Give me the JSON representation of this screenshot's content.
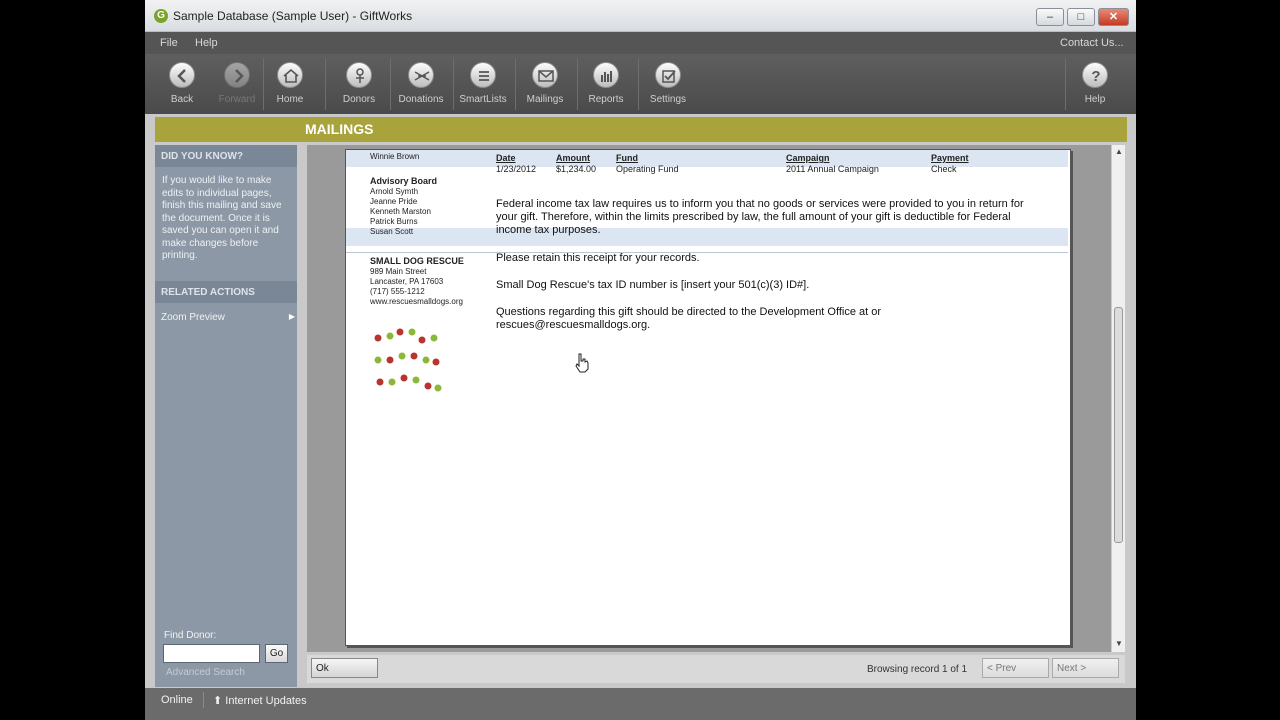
{
  "window": {
    "title": "Sample Database (Sample User) - GiftWorks",
    "app_icon": "G",
    "minimize_glyph": "–",
    "maximize_glyph": "□",
    "close_glyph": "✕"
  },
  "menu": {
    "file": "File",
    "help": "Help",
    "contact": "Contact Us..."
  },
  "toolbar": {
    "back": "Back",
    "forward": "Forward",
    "home": "Home",
    "donors": "Donors",
    "donations": "Donations",
    "smartlists": "SmartLists",
    "mailings": "Mailings",
    "reports": "Reports",
    "settings": "Settings",
    "help": "Help"
  },
  "banner": {
    "title": "MAILINGS"
  },
  "sidebar": {
    "did_you_know_title": "DID YOU KNOW?",
    "did_you_know_text": "If you would like to make edits to individual pages, finish this mailing and save the document. Once it is saved you can open it and make changes before printing.",
    "related_actions_title": "RELATED ACTIONS",
    "zoom_preview": "Zoom Preview",
    "zoom_arrow": "▶",
    "find_donor_label": "Find Donor:",
    "find_donor_value": "",
    "go": "Go",
    "advanced_search": "Advanced Search"
  },
  "letter": {
    "donor_name": "Winnie Brown",
    "columns": {
      "date": "Date",
      "amount": "Amount",
      "fund": "Fund",
      "campaign": "Campaign",
      "payment": "Payment"
    },
    "gift": {
      "date": "1/23/2012",
      "amount": "$1,234.00",
      "fund": "Operating Fund",
      "campaign": "2011 Annual Campaign",
      "payment": "Check"
    },
    "advisory_board_title": "Advisory Board",
    "advisory_board": [
      "Arnold Symth",
      "Jeanne Pride",
      "Kenneth Marston",
      "Patrick Burns",
      "Susan Scott"
    ],
    "org_name": "SMALL DOG RESCUE",
    "org_address": [
      "989 Main Street",
      "Lancaster, PA 17603",
      "(717) 555-1212",
      "www.rescuesmalldogs.org"
    ],
    "paragraph1": "Federal income tax law requires us to inform you that no goods or services were provided to you in return for your gift. Therefore, within the limits prescribed by law, the full amount of your gift is deductible for Federal income tax purposes.",
    "paragraph2": "Please retain this receipt for your records.",
    "paragraph3": "Small Dog Rescue's tax ID number is [insert your 501(c)(3) ID#].",
    "paragraph4": "Questions regarding this gift should be directed to the Development Office at  or rescues@rescuesmalldogs.org."
  },
  "bottom": {
    "ok": "Ok",
    "browsing": "Browsing record 1 of 1",
    "prev": "< Prev",
    "next": "Next >"
  },
  "status": {
    "online": "Online",
    "updates_icon": "⬆",
    "updates": "Internet Updates"
  },
  "scroll": {
    "up": "▲",
    "down": "▼"
  },
  "colors": {
    "banner": "#a8a43b",
    "sidebar": "#8c98a6",
    "toolbar": "#555555",
    "paw_red": "#b8342e",
    "paw_green": "#8cb83a"
  }
}
